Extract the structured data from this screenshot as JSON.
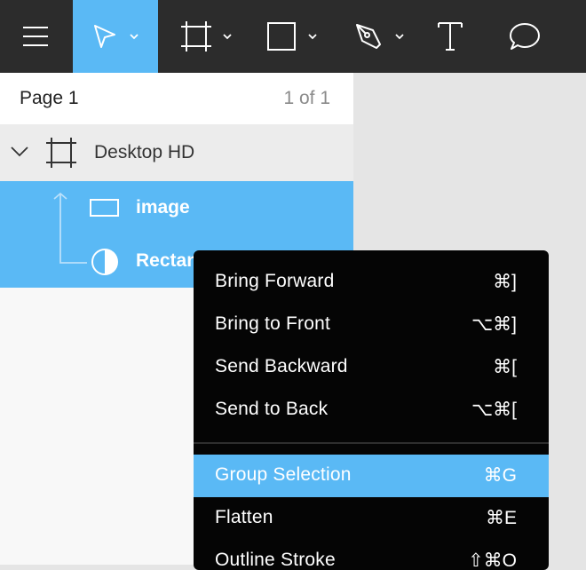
{
  "toolbar": {
    "tools": [
      {
        "name": "menu-icon"
      },
      {
        "name": "move-tool-icon",
        "active": true,
        "has_dropdown": true
      },
      {
        "name": "frame-tool-icon",
        "has_dropdown": true
      },
      {
        "name": "rectangle-tool-icon",
        "has_dropdown": true
      },
      {
        "name": "pen-tool-icon",
        "has_dropdown": true
      },
      {
        "name": "text-tool-icon"
      },
      {
        "name": "comment-tool-icon"
      }
    ],
    "accent_color": "#5ab9f5",
    "background_color": "#2c2c2c"
  },
  "pages": {
    "current": "Page 1",
    "count": "1 of 1"
  },
  "layers": {
    "frame": {
      "label": "Desktop HD",
      "icon": "frame-icon",
      "expanded": true
    },
    "children": [
      {
        "label": "image",
        "icon": "rectangle-icon"
      },
      {
        "label": "Rectan",
        "icon": "mask-circle-icon"
      }
    ]
  },
  "context_menu": {
    "items": [
      {
        "label": "Bring Forward",
        "shortcut": "⌘]"
      },
      {
        "label": "Bring to Front",
        "shortcut": "⌥⌘]"
      },
      {
        "label": "Send Backward",
        "shortcut": "⌘["
      },
      {
        "label": "Send to Back",
        "shortcut": "⌥⌘["
      },
      {
        "label": "Group Selection",
        "shortcut": "⌘G",
        "highlighted": true
      },
      {
        "label": "Flatten",
        "shortcut": "⌘E"
      },
      {
        "label": "Outline Stroke",
        "shortcut": "⇧⌘O"
      }
    ],
    "highlight_color": "#5ab9f5"
  }
}
